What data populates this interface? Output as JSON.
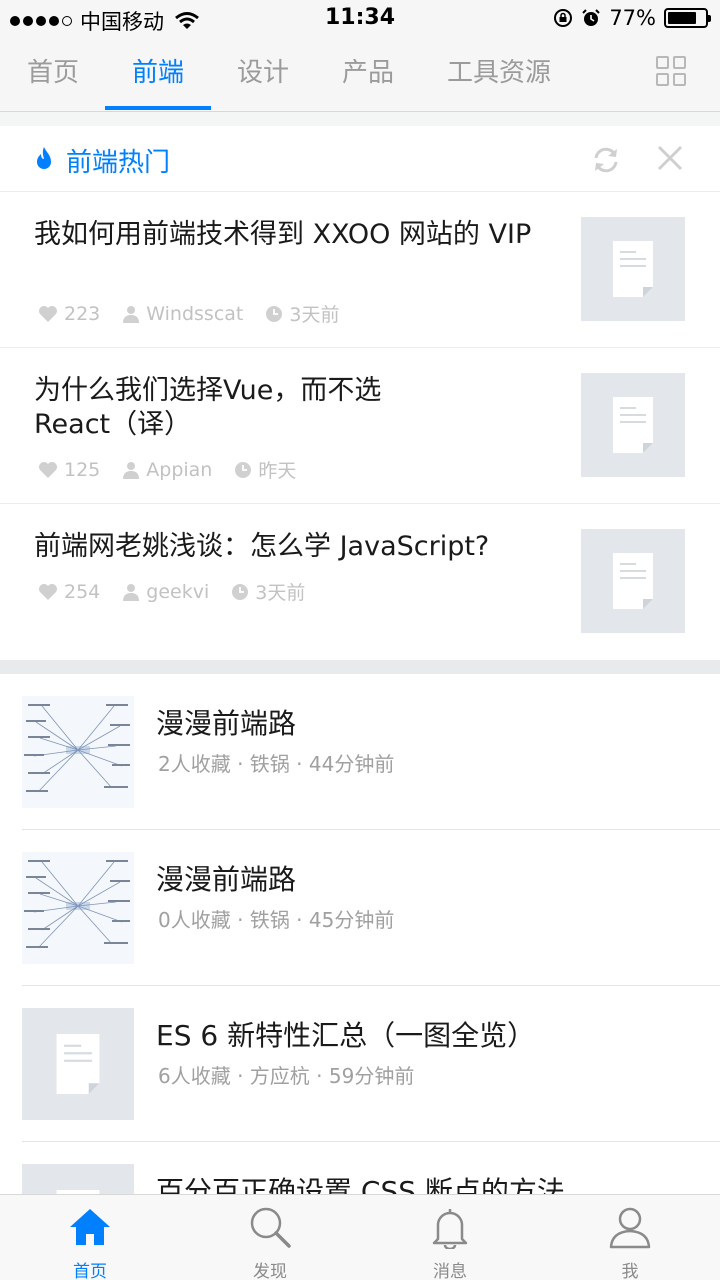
{
  "status_bar": {
    "carrier": "中国移动",
    "time": "11:34",
    "battery": "77%",
    "battery_level": 0.77
  },
  "tabs": [
    {
      "label": "首页",
      "active": false
    },
    {
      "label": "前端",
      "active": true
    },
    {
      "label": "设计",
      "active": false
    },
    {
      "label": "产品",
      "active": false
    },
    {
      "label": "工具资源",
      "active": false
    }
  ],
  "hot": {
    "title": "前端热门",
    "items": [
      {
        "title": "我如何用前端技术得到 XXOO 网站的 VIP",
        "likes": "223",
        "author": "Windsscat",
        "time": "3天前"
      },
      {
        "title": "为什么我们选择Vue，而不选 React（译）",
        "likes": "125",
        "author": "Appian",
        "time": "昨天"
      },
      {
        "title": "前端网老姚浅谈：怎么学 JavaScript?",
        "likes": "254",
        "author": "geekvi",
        "time": "3天前"
      }
    ]
  },
  "list": [
    {
      "title": "漫漫前端路",
      "meta": "2人收藏 · 铁锅 · 44分钟前",
      "thumb": "mindmap"
    },
    {
      "title": "漫漫前端路",
      "meta": "0人收藏 · 铁锅 · 45分钟前",
      "thumb": "mindmap"
    },
    {
      "title": "ES 6 新特性汇总（一图全览）",
      "meta": "6人收藏 · 方应杭 · 59分钟前",
      "thumb": "doc"
    },
    {
      "title": "百分百正确设置 CSS 断点的方法",
      "meta": "",
      "thumb": "doc"
    }
  ],
  "bottom_nav": [
    {
      "label": "首页",
      "icon": "home-icon",
      "active": true
    },
    {
      "label": "发现",
      "icon": "search-icon",
      "active": false
    },
    {
      "label": "消息",
      "icon": "bell-icon",
      "active": false
    },
    {
      "label": "我",
      "icon": "user-icon",
      "active": false
    }
  ],
  "colors": {
    "accent": "#007fff",
    "muted": "#9b9b9b"
  }
}
